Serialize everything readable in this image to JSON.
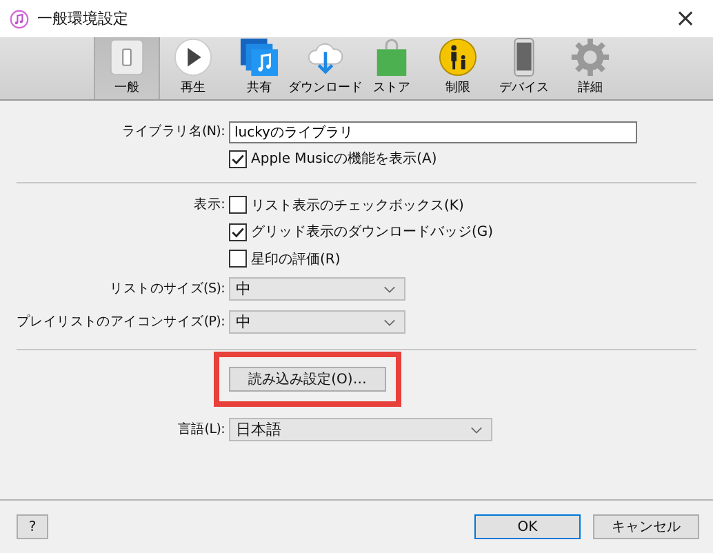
{
  "window": {
    "title": "一般環境設定",
    "close": "×"
  },
  "tabs": [
    {
      "label": "一般",
      "kind": "general",
      "selected": true
    },
    {
      "label": "再生",
      "kind": "play",
      "selected": false
    },
    {
      "label": "共有",
      "kind": "share",
      "selected": false
    },
    {
      "label": "ダウンロード",
      "kind": "download",
      "selected": false
    },
    {
      "label": "ストア",
      "kind": "store",
      "selected": false
    },
    {
      "label": "制限",
      "kind": "parental",
      "selected": false
    },
    {
      "label": "デバイス",
      "kind": "device",
      "selected": false
    },
    {
      "label": "詳細",
      "kind": "advanced",
      "selected": false
    }
  ],
  "library": {
    "label": "ライブラリ名(N):",
    "value": "luckyのライブラリ",
    "apple_music": {
      "label": "Apple Musicの機能を表示(A)",
      "checked": true
    }
  },
  "view": {
    "label": "表示:",
    "options": [
      {
        "label": "リスト表示のチェックボックス(K)",
        "checked": false
      },
      {
        "label": "グリッド表示のダウンロードバッジ(G)",
        "checked": true
      },
      {
        "label": "星印の評価(R)",
        "checked": false
      }
    ]
  },
  "sizes": [
    {
      "label": "リストのサイズ(S):",
      "value": "中"
    },
    {
      "label": "プレイリストのアイコンサイズ(P):",
      "value": "中"
    }
  ],
  "import_button": {
    "label": "読み込み設定(O)…",
    "highlighted": true
  },
  "language": {
    "label": "言語(L):",
    "value": "日本語"
  },
  "footer": {
    "help": "?",
    "ok": "OK",
    "cancel": "キャンセル"
  }
}
